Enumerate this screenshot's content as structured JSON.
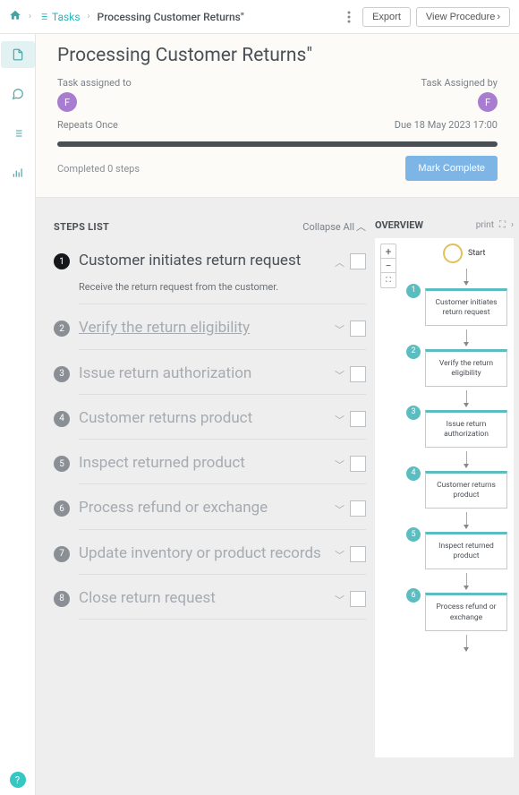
{
  "breadcrumb": {
    "tasks_label": "Tasks",
    "current": "Processing Customer Returns\""
  },
  "topbar": {
    "export_label": "Export",
    "view_procedure_label": "View Procedure"
  },
  "header": {
    "title": "Processing Customer Returns\"",
    "assigned_to_label": "Task assigned to",
    "assigned_by_label": "Task Assigned by",
    "assigned_to_initial": "F",
    "assigned_by_initial": "F",
    "repeats": "Repeats Once",
    "due": "Due 18 May 2023 17:00",
    "completed_text": "Completed 0 steps",
    "mark_complete_label": "Mark Complete"
  },
  "steps_panel": {
    "title": "STEPS LIST",
    "collapse_all": "Collapse All"
  },
  "steps": [
    {
      "num": "1",
      "title": "Customer initiates return request",
      "desc": "Receive the return request from the customer.",
      "expanded": true
    },
    {
      "num": "2",
      "title": "Verify the return eligibility"
    },
    {
      "num": "3",
      "title": "Issue return authorization"
    },
    {
      "num": "4",
      "title": "Customer returns product"
    },
    {
      "num": "5",
      "title": "Inspect returned product"
    },
    {
      "num": "6",
      "title": "Process refund or exchange"
    },
    {
      "num": "7",
      "title": "Update inventory or product records"
    },
    {
      "num": "8",
      "title": "Close return request"
    }
  ],
  "overview": {
    "title": "OVERVIEW",
    "print_label": "print",
    "start_label": "Start",
    "nodes": [
      {
        "num": "1",
        "label": "Customer initiates return request"
      },
      {
        "num": "2",
        "label": "Verify the return eligibility"
      },
      {
        "num": "3",
        "label": "Issue return authorization"
      },
      {
        "num": "4",
        "label": "Customer returns product"
      },
      {
        "num": "5",
        "label": "Inspect returned product"
      },
      {
        "num": "6",
        "label": "Process refund or exchange"
      }
    ]
  }
}
